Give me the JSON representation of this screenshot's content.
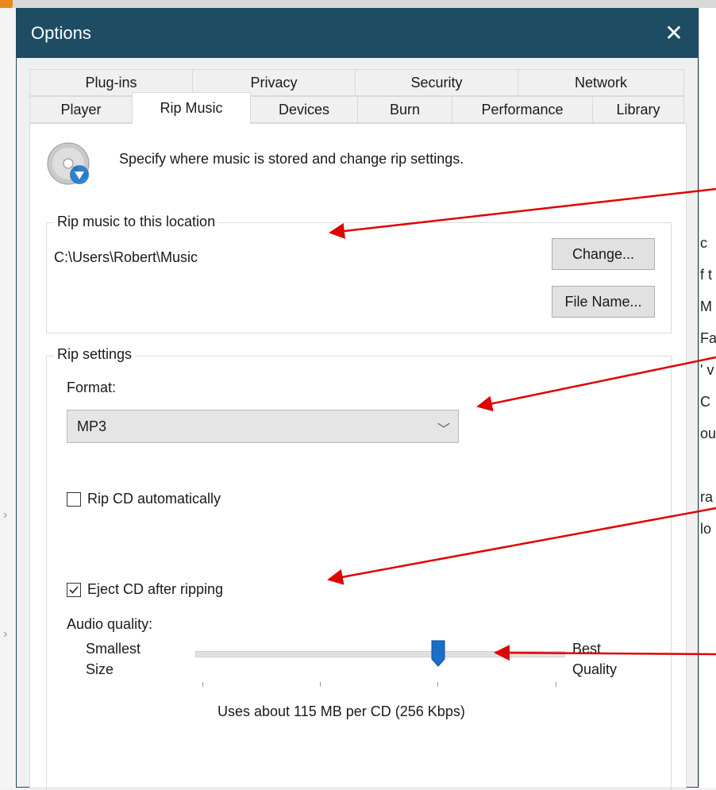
{
  "dialog": {
    "title": "Options",
    "close_glyph": "✕"
  },
  "tabs_row1": [
    {
      "label": "Plug-ins"
    },
    {
      "label": "Privacy"
    },
    {
      "label": "Security"
    },
    {
      "label": "Network"
    }
  ],
  "tabs_row2": [
    {
      "label": "Player"
    },
    {
      "label": "Rip Music",
      "active": true
    },
    {
      "label": "Devices"
    },
    {
      "label": "Burn"
    },
    {
      "label": "Performance"
    },
    {
      "label": "Library"
    }
  ],
  "header": {
    "icon": "cd-rip-icon",
    "description": "Specify where music is stored and change rip settings."
  },
  "location_group": {
    "legend": "Rip music to this location",
    "path": "C:\\Users\\Robert\\Music",
    "change_button": "Change...",
    "filename_button": "File Name..."
  },
  "settings_group": {
    "legend": "Rip settings",
    "format_label": "Format:",
    "format_value": "MP3",
    "rip_auto_label": "Rip CD automatically",
    "rip_auto_checked": false,
    "eject_label": "Eject CD after ripping",
    "eject_checked": true,
    "audio_quality_label": "Audio quality:",
    "slider_min_line1": "Smallest",
    "slider_min_line2": "Size",
    "slider_max_line1": "Best",
    "slider_max_line2": "Quality",
    "slider_fraction": 0.66,
    "usage_text": "Uses about 115 MB per CD (256 Kbps)"
  },
  "background_snippets": [
    "c",
    "f t",
    "M",
    "Fal",
    "' v",
    "C",
    "ou",
    "ra",
    "lo"
  ],
  "colors": {
    "titlebar": "#1e4d63",
    "slider_thumb": "#1a6fc9",
    "annotation_arrow": "#e00000"
  }
}
